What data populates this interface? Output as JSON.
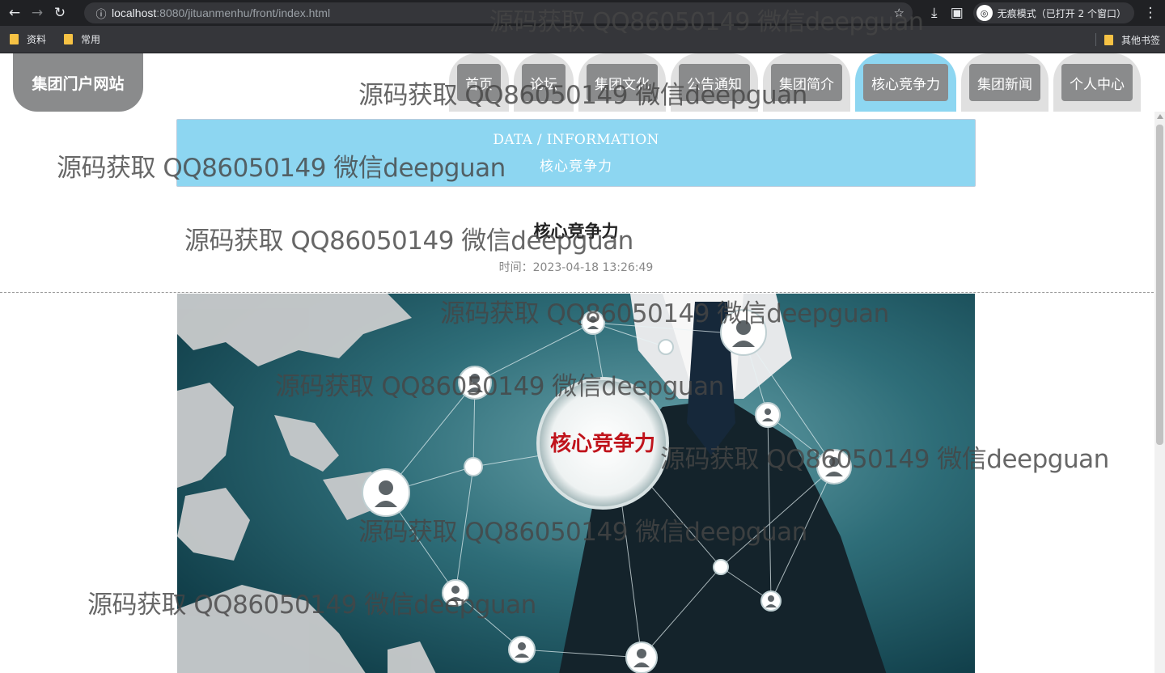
{
  "browser": {
    "back": "←",
    "forward": "→",
    "reload": "↻",
    "info_icon": "ⓘ",
    "url_host": "localhost",
    "url_rest": ":8080/jituanmenhu/front/index.html",
    "star": "☆",
    "download": "⤓",
    "sidebar": "▣",
    "incognito_label": "无痕模式（已打开 2 个窗口）",
    "incognito_icon": "◎",
    "menu": "⋮"
  },
  "bookmarks": {
    "items": [
      {
        "label": "资料"
      },
      {
        "label": "常用"
      }
    ],
    "other": "其他书签"
  },
  "site": {
    "logo": "集团门户网站",
    "nav": [
      {
        "label": "首页"
      },
      {
        "label": "论坛"
      },
      {
        "label": "集团文化"
      },
      {
        "label": "公告通知"
      },
      {
        "label": "集团简介"
      },
      {
        "label": "核心竞争力",
        "active": true
      },
      {
        "label": "集团新闻"
      },
      {
        "label": "个人中心"
      }
    ]
  },
  "banner": {
    "en": "DATA / INFORMATION",
    "zh": "核心竞争力"
  },
  "article": {
    "title": "核心竞争力",
    "time_label": "时间：",
    "time_value": "2023-04-18 13:26:49",
    "image_caption": "核心竞争力"
  },
  "watermark": "源码获取 QQ86050149 微信deepguan",
  "colors": {
    "accent": "#8dd6f1",
    "nav_gray": "#8a8b8c",
    "tab_bg": "#e0e0e0"
  }
}
